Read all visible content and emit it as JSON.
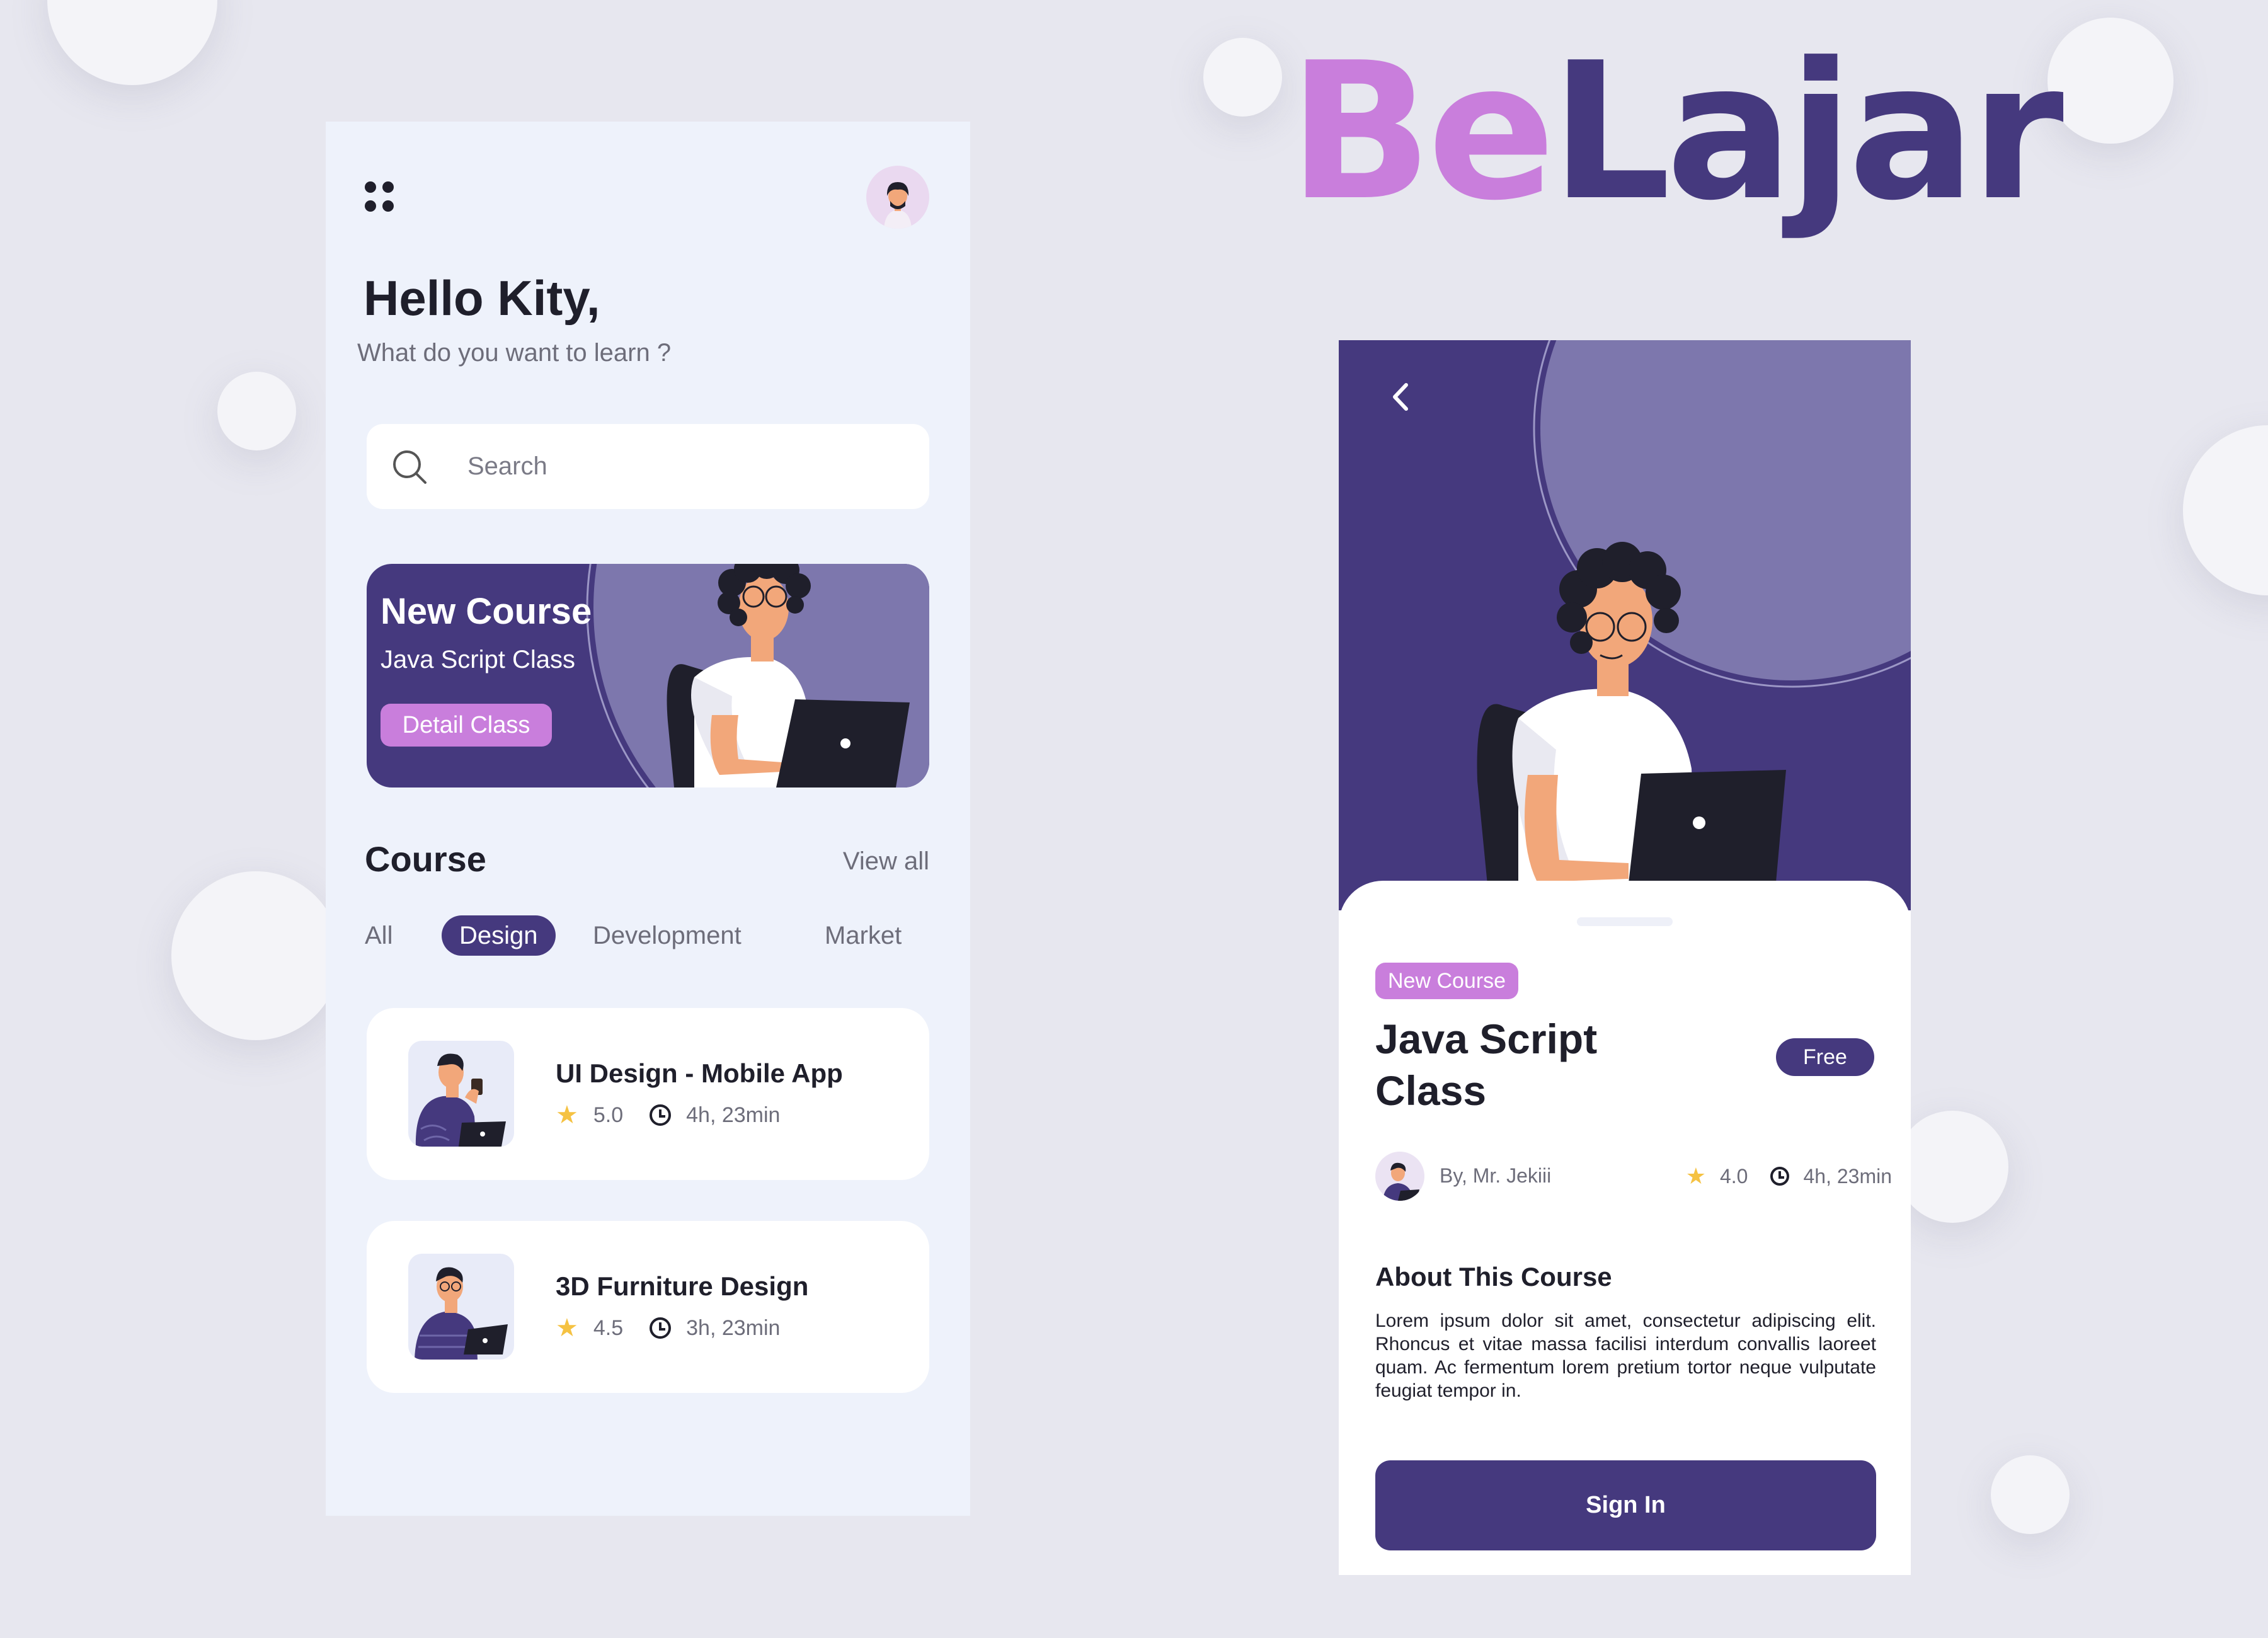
{
  "logo": {
    "part1": "Be",
    "part2": "Lajar"
  },
  "colors": {
    "primary": "#45397E",
    "accent": "#C97EDC",
    "star": "#F5C242",
    "background": "#E7E7EF"
  },
  "home": {
    "menu_icon": "grid-dots-icon",
    "greeting": "Hello Kity,",
    "subtitle": "What do you want to learn ?",
    "search": {
      "placeholder": "Search",
      "icon": "search-icon"
    },
    "banner": {
      "title": "New Course",
      "subtitle": "Java Script Class",
      "button": "Detail Class"
    },
    "section_title": "Course",
    "view_all": "View all",
    "tabs": [
      {
        "label": "All",
        "active": false
      },
      {
        "label": "Design",
        "active": true
      },
      {
        "label": "Development",
        "active": false
      },
      {
        "label": "Market",
        "active": false
      }
    ],
    "courses": [
      {
        "title": "UI Design - Mobile App",
        "rating": "5.0",
        "duration": "4h, 23min"
      },
      {
        "title": "3D Furniture Design",
        "rating": "4.5",
        "duration": "3h, 23min"
      }
    ]
  },
  "detail": {
    "back_icon": "chevron-left-icon",
    "tag": "New Course",
    "title": "Java Script Class",
    "price_badge": "Free",
    "author": "By, Mr. Jekiii",
    "rating": "4.0",
    "duration": "4h, 23min",
    "about_title": "About This Course",
    "about_text": "Lorem ipsum dolor sit amet, consectetur adipiscing elit. Rhoncus et vitae massa facilisi interdum convallis laoreet quam. Ac fermentum lorem pretium tortor neque vulputate feugiat tempor in.",
    "cta": "Sign In"
  }
}
